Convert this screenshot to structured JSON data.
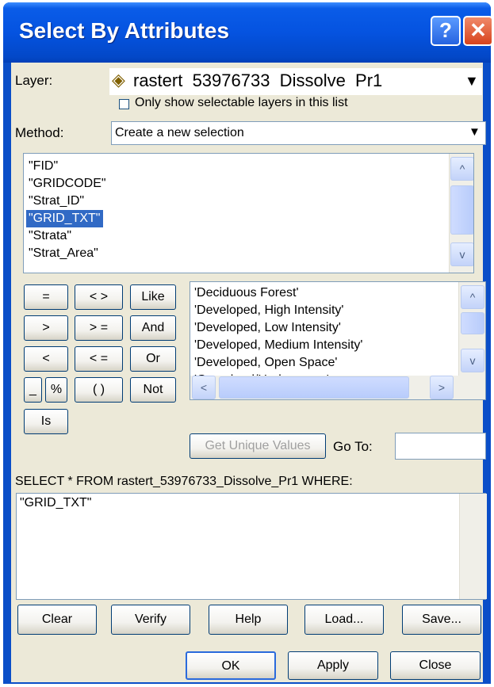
{
  "window": {
    "title": "Select By Attributes",
    "help_glyph": "?",
    "close_glyph": "✕"
  },
  "layer": {
    "label": "Layer:",
    "value": "rastert  53976733  Dissolve  Pr1",
    "layer_icon": "layer-diamond-icon",
    "dropdown_glyph": "▼"
  },
  "only_selectable": {
    "label": "Only show selectable layers in this list",
    "checked": false
  },
  "method": {
    "label": "Method:",
    "value": "Create a new selection",
    "dropdown_glyph": "▼"
  },
  "fields": {
    "items": [
      "\"FID\"",
      "\"GRIDCODE\"",
      "\"Strat_ID\"",
      "\"GRID_TXT\"",
      "\"Strata\"",
      "\"Strat_Area\""
    ],
    "selected": "\"GRID_TXT\""
  },
  "operators": {
    "eq": "=",
    "ne": "< >",
    "like": "Like",
    "gt": ">",
    "ge": "> =",
    "and": "And",
    "lt": "<",
    "le": "< =",
    "or": "Or",
    "underscore": "_",
    "percent": "%",
    "parens": "( )",
    "not": "Not",
    "is": "Is"
  },
  "values": {
    "items": [
      "'Deciduous Forest'",
      "'Developed, High Intensity'",
      "'Developed, Low Intensity'",
      "'Developed, Medium Intensity'",
      "'Developed, Open Space'",
      "'Grassland/Herbaceous'"
    ]
  },
  "scroll": {
    "up": "^",
    "down": "v",
    "left": "<",
    "right": ">"
  },
  "get_unique_values_label": "Get Unique Values",
  "goto": {
    "label": "Go To:",
    "value": ""
  },
  "select_statement": "SELECT * FROM rastert_53976733_Dissolve_Pr1 WHERE:",
  "where_clause": "\"GRID_TXT\"",
  "actions": {
    "clear": "Clear",
    "verify": "Verify",
    "help": "Help",
    "load": "Load...",
    "save": "Save..."
  },
  "footer": {
    "ok": "OK",
    "apply": "Apply",
    "close": "Close"
  },
  "colors": {
    "title_bar": "#0553e0",
    "dialog_bg": "#ece9d8",
    "selection": "#316ac5"
  }
}
